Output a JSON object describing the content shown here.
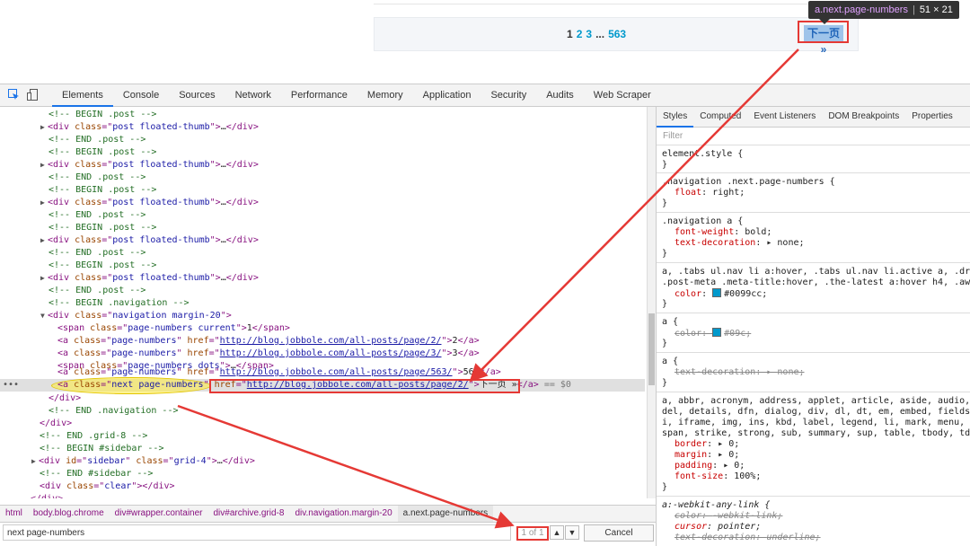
{
  "page": {
    "pager": {
      "current": "1",
      "page2": "2",
      "page3": "3",
      "dots": "...",
      "last": "563"
    },
    "next_label": "下一页 »",
    "tooltip": {
      "selector": "a.next.page-numbers",
      "size": "51 × 21"
    }
  },
  "devtools": {
    "tabs": [
      "Elements",
      "Console",
      "Sources",
      "Network",
      "Performance",
      "Memory",
      "Application",
      "Security",
      "Audits",
      "Web Scraper"
    ],
    "elements": {
      "begin_post": "<!-- BEGIN .post -->",
      "end_post": "<!-- END .post -->",
      "post_div": "post floated-thumb",
      "begin_nav": "<!-- BEGIN .navigation -->",
      "nav_class": "navigation margin-20",
      "current_class": "page-numbers current",
      "current_text": "1",
      "pn_class": "page-numbers",
      "href2": "http://blog.jobbole.com/all-posts/page/2/",
      "text2": "2",
      "href3": "http://blog.jobbole.com/all-posts/page/3/",
      "text3": "3",
      "dots_class": "page-numbers dots",
      "dots_text": "…",
      "href563": "http://blog.jobbole.com/all-posts/page/563/",
      "text563": "563",
      "next_class": "next page-numbers",
      "next_href": "http://blog.jobbole.com/all-posts/page/2/",
      "next_text": "下一页 »",
      "dollar0": "== $0",
      "end_nav": "<!-- END .navigation -->",
      "end_grid": "<!-- END .grid-8 -->",
      "begin_sidebar": "<!-- BEGIN #sidebar -->",
      "sidebar_id": "sidebar",
      "sidebar_class": "grid-4",
      "end_sidebar": "<!-- END #sidebar -->",
      "clear_class": "clear"
    },
    "breadcrumb": [
      "html",
      "body.blog.chrome",
      "div#wrapper.container",
      "div#archive.grid-8",
      "div.navigation.margin-20",
      "a.next.page-numbers"
    ],
    "search": {
      "value": "next page-numbers",
      "match": "1 of 1",
      "cancel": "Cancel"
    },
    "styles": {
      "tabs": [
        "Styles",
        "Computed",
        "Event Listeners",
        "DOM Breakpoints",
        "Properties"
      ],
      "filter": "Filter",
      "element_style": "element.style {",
      "rule1_sel": ".navigation .next.page-numbers {",
      "rule1_prop": "float",
      "rule1_val": "right;",
      "rule2_sel": ".navigation a {",
      "rule2_p1": "font-weight",
      "rule2_v1": "bold;",
      "rule2_p2": "text-decoration",
      "rule2_v2": "none;",
      "rule3_sel1": "a, .tabs ul.nav li a:hover, .tabs ul.nav li.active a, .dr",
      "rule3_sel2": ".post-meta .meta-title:hover, .the-latest a:hover h4, .aw",
      "rule3_prop": "color",
      "rule3_val": "#0099cc;",
      "rule4_sel": "a {",
      "rule4_prop": "color",
      "rule4_val": "#09c;",
      "rule5_sel": "a {",
      "rule5_prop": "text-decoration",
      "rule5_val": "none;",
      "rule6_l1": "a, abbr, acronym, address, applet, article, aside, audio,",
      "rule6_l2": "del, details, dfn, dialog, div, dl, dt, em, embed, fields",
      "rule6_l3": "i, iframe, img, ins, kbd, label, legend, li, mark, menu,",
      "rule6_l4": "span, strike, strong, sub, summary, sup, table, tbody, td",
      "rule6_p1": "border",
      "rule6_v1": "0;",
      "rule6_p2": "margin",
      "rule6_v2": "0;",
      "rule6_p3": "padding",
      "rule6_v3": "0;",
      "rule6_p4": "font-size",
      "rule6_v4": "100%;",
      "rule7_sel": "a:-webkit-any-link {",
      "rule7_p1": "color",
      "rule7_v1": "-webkit-link;",
      "rule7_p2": "cursor",
      "rule7_v2": "pointer;",
      "rule7_p3": "text-decoration",
      "rule7_v3": "underline;",
      "close": "}"
    }
  },
  "colors": {
    "accent": "#1a73e8",
    "annotation": "#e53935",
    "link": "#0099cc"
  }
}
